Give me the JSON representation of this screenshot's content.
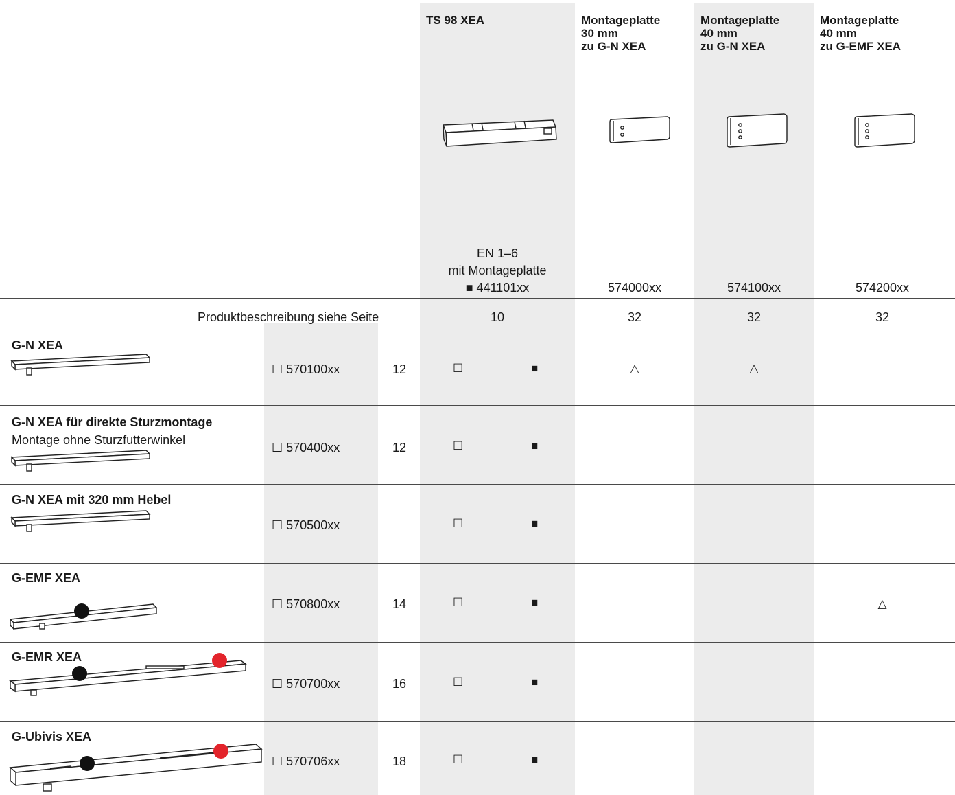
{
  "header": {
    "columns": [
      {
        "lines": [
          "TS 98 XEA"
        ],
        "image": "ts98-closer-illustration",
        "note_lines": [
          "EN 1–6",
          "mit Montageplatte"
        ],
        "article": "■ 441101xx",
        "page": "10"
      },
      {
        "lines": [
          "Montageplatte",
          "30 mm",
          "zu G-N XEA"
        ],
        "image": "mounting-plate-illustration",
        "article": "574000xx",
        "page": "32"
      },
      {
        "lines": [
          "Montageplatte",
          "40 mm",
          "zu G-N XEA"
        ],
        "image": "mounting-plate-illustration",
        "article": "574100xx",
        "page": "32"
      },
      {
        "lines": [
          "Montageplatte",
          "40 mm",
          "zu G-EMF XEA"
        ],
        "image": "mounting-plate-illustration",
        "article": "574200xx",
        "page": "32"
      }
    ],
    "product_description_label": "Produktbeschreibung siehe Seite"
  },
  "rows": [
    {
      "title": "G-N XEA",
      "subtitle": "",
      "article": "☐ 570100xx",
      "page": "12",
      "ts98_open": "☐",
      "ts98_filled": "■",
      "mp30": "△",
      "mp40gn": "△",
      "mp40emf": ""
    },
    {
      "title": "G-N XEA für direkte Sturzmontage",
      "subtitle": "Montage ohne Sturzfutterwinkel",
      "article": "☐ 570400xx",
      "page": "12",
      "ts98_open": "☐",
      "ts98_filled": "■",
      "mp30": "",
      "mp40gn": "",
      "mp40emf": ""
    },
    {
      "title": "G-N XEA mit 320 mm Hebel",
      "subtitle": "",
      "article": "☐ 570500xx",
      "page": "",
      "ts98_open": "☐",
      "ts98_filled": "■",
      "mp30": "",
      "mp40gn": "",
      "mp40emf": ""
    },
    {
      "title": "G-EMF XEA",
      "subtitle": "",
      "article": "☐ 570800xx",
      "page": "14",
      "ts98_open": "☐",
      "ts98_filled": "■",
      "mp30": "",
      "mp40gn": "",
      "mp40emf": "△"
    },
    {
      "title": "G-EMR XEA",
      "subtitle": "",
      "article": "☐ 570700xx",
      "page": "16",
      "ts98_open": "☐",
      "ts98_filled": "■",
      "mp30": "",
      "mp40gn": "",
      "mp40emf": ""
    },
    {
      "title": "G-Ubivis XEA",
      "subtitle": "",
      "article": "☐  570706xx",
      "page": "18",
      "ts98_open": "☐",
      "ts98_filled": "■",
      "mp30": "",
      "mp40gn": "",
      "mp40emf": ""
    }
  ],
  "colors": {
    "band": "#ececec",
    "rule": "#4a4a4a",
    "marker_black": "#111111",
    "marker_red": "#e3242b"
  }
}
